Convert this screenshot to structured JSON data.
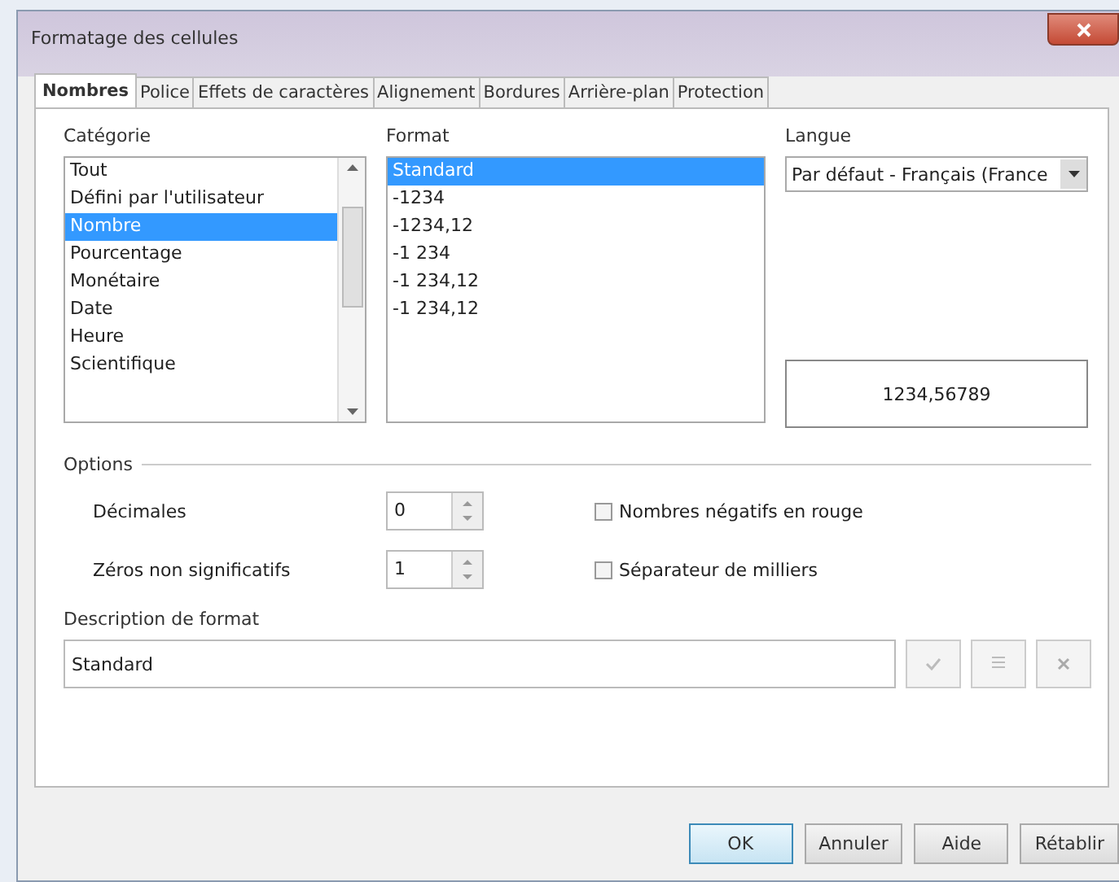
{
  "window": {
    "title": "Formatage des cellules"
  },
  "tabs": [
    {
      "label": "Nombres",
      "selected": true
    },
    {
      "label": "Police",
      "selected": false
    },
    {
      "label": "Effets de caractères",
      "selected": false
    },
    {
      "label": "Alignement",
      "selected": false
    },
    {
      "label": "Bordures",
      "selected": false
    },
    {
      "label": "Arrière-plan",
      "selected": false
    },
    {
      "label": "Protection",
      "selected": false
    }
  ],
  "category": {
    "label": "Catégorie",
    "items": [
      {
        "label": "Tout",
        "selected": false
      },
      {
        "label": "Défini par l'utilisateur",
        "selected": false
      },
      {
        "label": "Nombre",
        "selected": true
      },
      {
        "label": "Pourcentage",
        "selected": false
      },
      {
        "label": "Monétaire",
        "selected": false
      },
      {
        "label": "Date",
        "selected": false
      },
      {
        "label": "Heure",
        "selected": false
      },
      {
        "label": "Scientifique",
        "selected": false
      }
    ]
  },
  "format": {
    "label": "Format",
    "items": [
      {
        "label": "Standard",
        "selected": true
      },
      {
        "label": "-1234",
        "selected": false
      },
      {
        "label": "-1234,12",
        "selected": false
      },
      {
        "label": "-1 234",
        "selected": false
      },
      {
        "label": "-1 234,12",
        "selected": false
      },
      {
        "label": "-1 234,12",
        "selected": false
      }
    ]
  },
  "language": {
    "label": "Langue",
    "value": "Par défaut - Français (France"
  },
  "preview": "1234,56789",
  "options": {
    "title": "Options",
    "decimals": {
      "label": "Décimales",
      "value": "0"
    },
    "leading_zeros": {
      "label": "Zéros non significatifs",
      "value": "1"
    },
    "negative_red": {
      "label": "Nombres négatifs en rouge",
      "checked": false
    },
    "thousands_separator": {
      "label": "Séparateur de milliers",
      "checked": false
    }
  },
  "format_code": {
    "label": "Description de format",
    "value": "Standard"
  },
  "buttons": [
    {
      "label": "OK",
      "default": true
    },
    {
      "label": "Annuler",
      "default": false
    },
    {
      "label": "Aide",
      "default": false
    },
    {
      "label": "Rétablir",
      "default": false
    }
  ]
}
